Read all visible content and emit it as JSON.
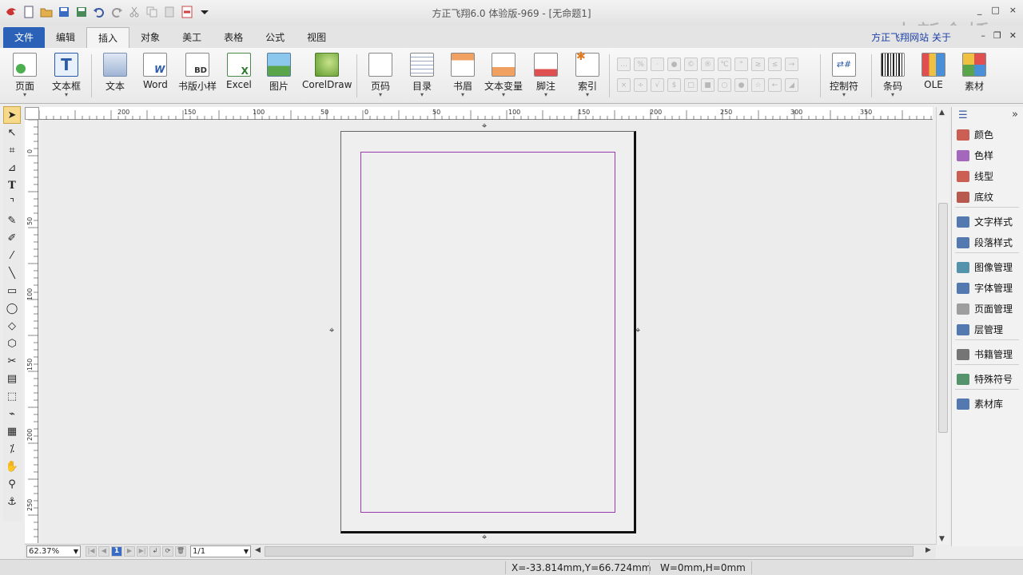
{
  "window": {
    "title": "方正飞翔6.0 体验版-969 - [无命题1]",
    "watermark": "中新金桥",
    "controls": [
      "_",
      "□",
      "×"
    ]
  },
  "quick_access": [
    "app-logo-icon",
    "new-icon",
    "open-icon",
    "save-icon",
    "save-as-icon",
    "undo-icon",
    "redo-icon",
    "cut-icon",
    "copy-icon",
    "paste-icon",
    "pdf-icon",
    "dropdown-icon"
  ],
  "tabs": [
    {
      "label": "文件",
      "state": "file"
    },
    {
      "label": "编辑",
      "state": ""
    },
    {
      "label": "插入",
      "state": "active"
    },
    {
      "label": "对象",
      "state": ""
    },
    {
      "label": "美工",
      "state": ""
    },
    {
      "label": "表格",
      "state": ""
    },
    {
      "label": "公式",
      "state": ""
    },
    {
      "label": "视图",
      "state": ""
    }
  ],
  "top_right": {
    "links": "方正飞翔网站  关于"
  },
  "ribbon": {
    "page": "页面",
    "textframe": "文本框",
    "text": "文本",
    "word": "Word",
    "bookstyle": "书版小样",
    "excel": "Excel",
    "picture": "图片",
    "coreldraw": "CorelDraw",
    "pagenum": "页码",
    "toc": "目录",
    "header": "书眉",
    "textvar": "文本变量",
    "footnote": "脚注",
    "index": "索引",
    "control": "控制符",
    "barcode": "条码",
    "ole": "OLE",
    "material": "素材"
  },
  "ruler_labels": [
    "200",
    "150",
    "100",
    "50",
    "0",
    "50",
    "100",
    "150",
    "200",
    "250",
    "300",
    "350"
  ],
  "ruler_left_labels": [
    "0",
    "50",
    "100",
    "150",
    "200",
    "250"
  ],
  "bottom": {
    "zoom": "62.37%",
    "current_page": "1",
    "page_count": "1/1"
  },
  "panel": {
    "items": [
      {
        "label": "颜色",
        "icon": "color-icon",
        "color": "#c0392b"
      },
      {
        "label": "色样",
        "icon": "swatch-icon",
        "color": "#8e44ad"
      },
      {
        "label": "线型",
        "icon": "linetype-icon",
        "color": "#c0392b"
      },
      {
        "label": "底纹",
        "icon": "pattern-icon",
        "color": "#a93226"
      },
      {
        "label": "文字样式",
        "icon": "text-style-icon",
        "color": "#2c5aa0"
      },
      {
        "label": "段落样式",
        "icon": "para-style-icon",
        "color": "#2c5aa0"
      },
      {
        "label": "图像管理",
        "icon": "image-manager-icon",
        "color": "#2c7a9a"
      },
      {
        "label": "字体管理",
        "icon": "font-manager-icon",
        "color": "#2c5aa0"
      },
      {
        "label": "页面管理",
        "icon": "page-manager-icon",
        "color": "#888888"
      },
      {
        "label": "层管理",
        "icon": "layer-manager-icon",
        "color": "#2c5aa0"
      },
      {
        "label": "书籍管理",
        "icon": "book-manager-icon",
        "color": "#555555"
      },
      {
        "label": "特殊符号",
        "icon": "special-symbol-icon",
        "color": "#2c7a4a"
      },
      {
        "label": "素材库",
        "icon": "material-lib-icon",
        "color": "#2c5aa0"
      }
    ]
  },
  "status": {
    "coords": "X=-33.814mm,Y=66.724mm",
    "size": "W=0mm,H=0mm"
  },
  "colors": {
    "accent": "#2b62b8",
    "margin_guide": "#9a3ab0"
  }
}
